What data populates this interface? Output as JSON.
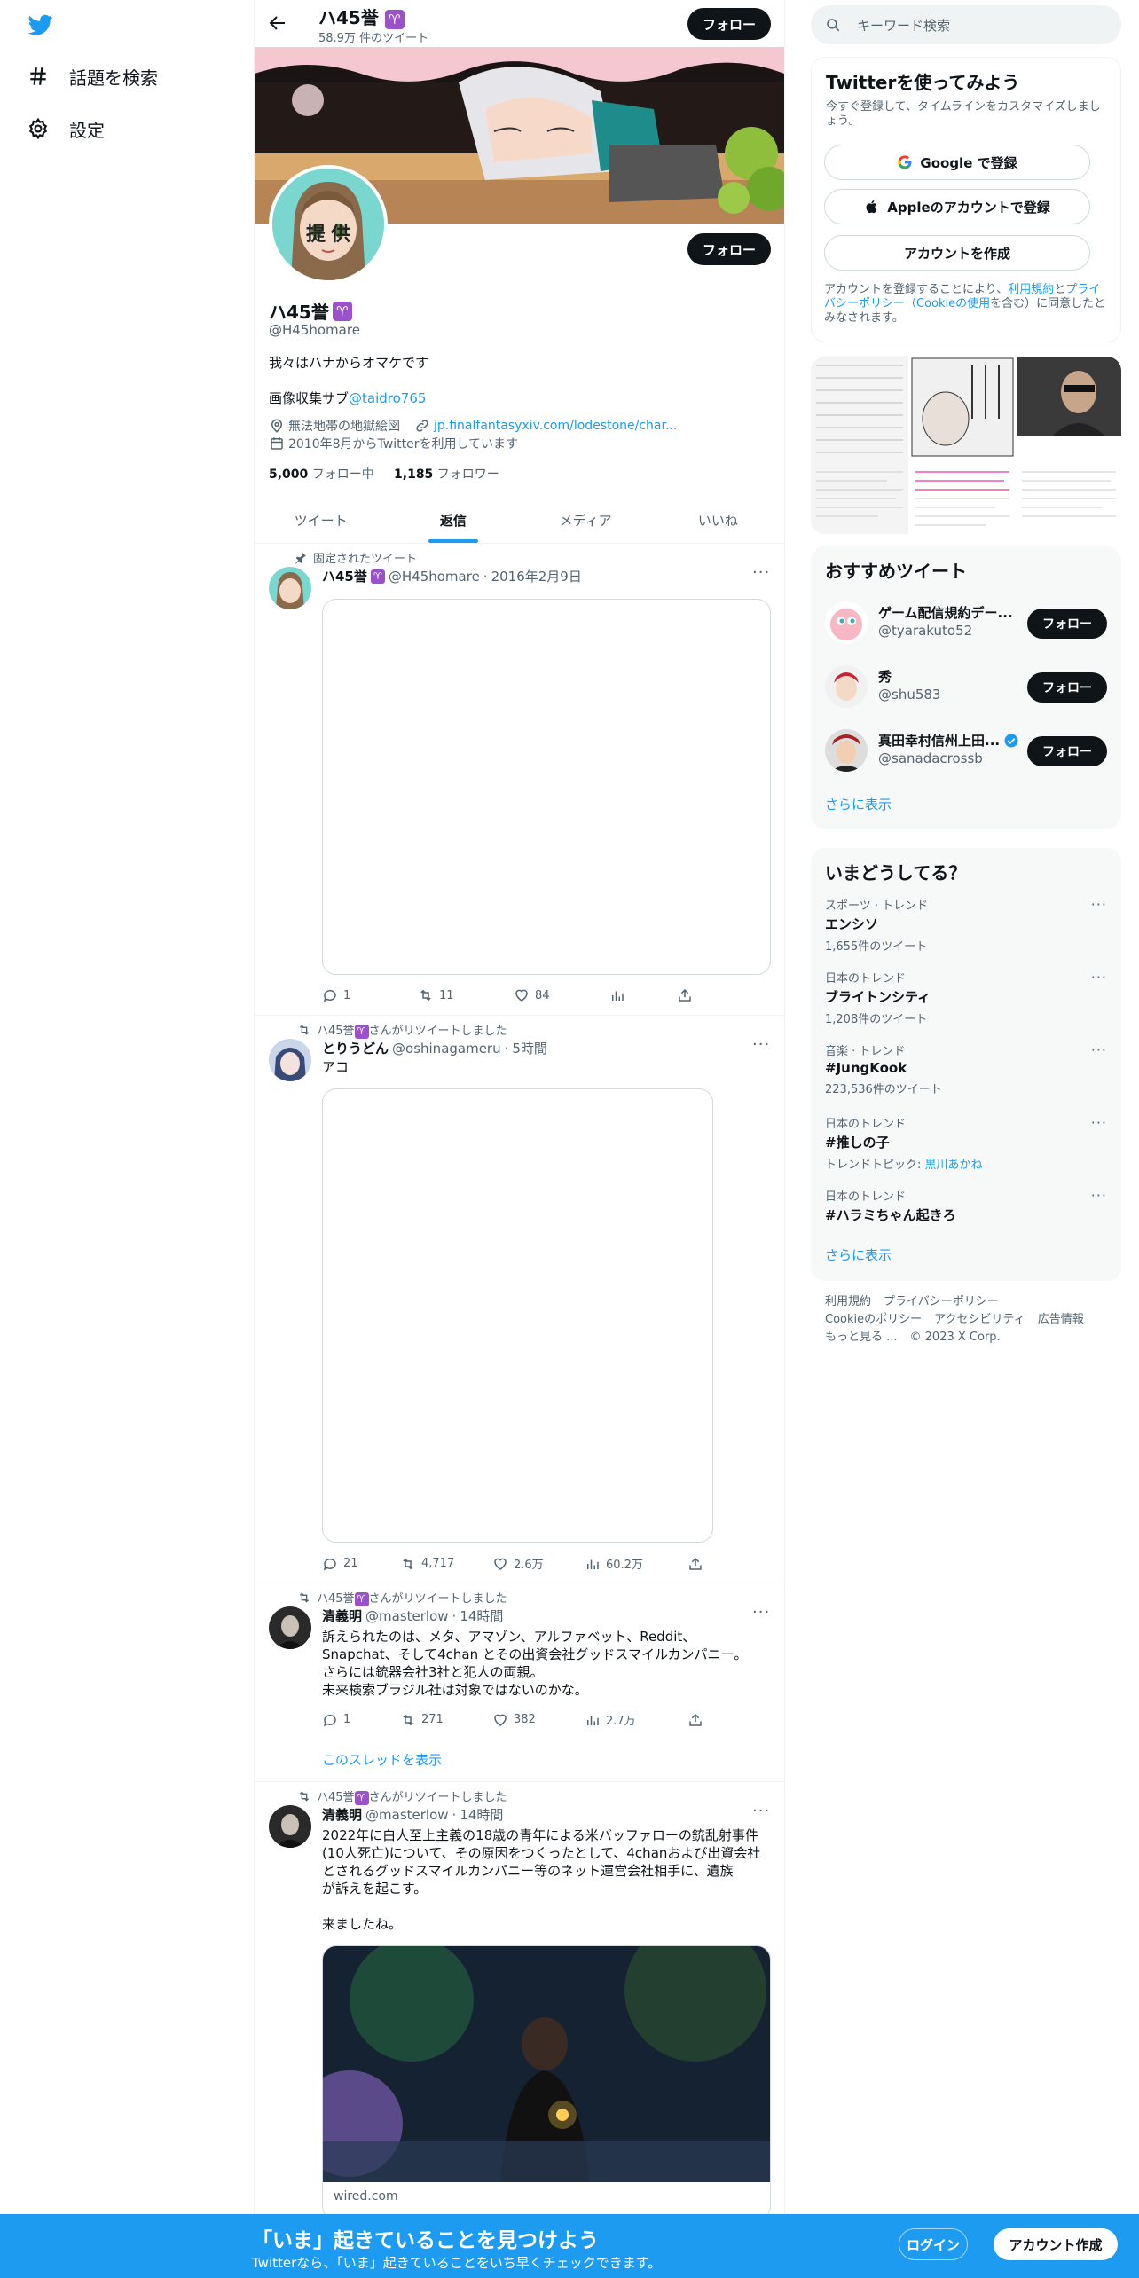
{
  "nav": {
    "items": [
      {
        "label": "話題を検索",
        "icon": "hashtag-icon"
      },
      {
        "label": "設定",
        "icon": "gear-icon"
      }
    ]
  },
  "header": {
    "name": "ハ45誉",
    "tweet_count": "58.9万 件のツイート",
    "follow_label": "フォロー"
  },
  "profile": {
    "avatar_label": "提供",
    "follow_label": "フォロー",
    "name": "ハ45誉",
    "handle": "@H45homare",
    "bio_line1": "我々はハナからオマケです",
    "bio_line2_prefix": "画像収集サブ",
    "bio_line2_link": "@taidro765",
    "location": "無法地帯の地獄絵図",
    "website": "jp.finalfantasyxiv.com/lodestone/char...",
    "joined": "2010年8月からTwitterを利用しています",
    "following_count": "5,000",
    "following_label": "フォロー中",
    "followers_count": "1,185",
    "followers_label": "フォロワー"
  },
  "tabs": [
    {
      "label": "ツイート",
      "active": false
    },
    {
      "label": "返信",
      "active": true
    },
    {
      "label": "メディア",
      "active": false
    },
    {
      "label": "いいね",
      "active": false
    }
  ],
  "tweets": [
    {
      "context": "固定されたツイート",
      "name": "ハ45誉",
      "handle": "@H45homare",
      "time": "2016年2月9日",
      "text": "",
      "replies": "1",
      "retweets": "11",
      "likes": "84",
      "views": ""
    },
    {
      "context_prefix": "ハ45誉",
      "context_suffix": "さんがリツイートしました",
      "name": "とりうどん",
      "handle": "@oshinagameru",
      "time": "5時間",
      "text": "アコ",
      "replies": "21",
      "retweets": "4,717",
      "likes": "2.6万",
      "views": "60.2万"
    },
    {
      "context_prefix": "ハ45誉",
      "context_suffix": "さんがリツイートしました",
      "name": "清義明",
      "handle": "@masterlow",
      "time": "14時間",
      "text": "訴えられたのは、メタ、アマゾン、アルファベット、Reddit、Snapchat、そして4chan とその出資会社グッドスマイルカンパニー。\nさらには銃器会社3社と犯人の両親。\n未来検索ブラジル社は対象ではないのかな。",
      "replies": "1",
      "retweets": "271",
      "likes": "382",
      "views": "2.7万",
      "show_thread": "このスレッドを表示"
    },
    {
      "context_prefix": "ハ45誉",
      "context_suffix": "さんがリツイートしました",
      "name": "清義明",
      "handle": "@masterlow",
      "time": "14時間",
      "text": "2022年に白人至上主義の18歳の青年による米バッファローの銃乱射事件(10人死亡)について、その原因をつくったとして、4chanおよび出資会社とされるグッドスマイルカンパニー等のネット運営会社相手に、遺族\nが訴えを起こす。\n\n来ましたね。",
      "link_domain": "wired.com"
    }
  ],
  "right": {
    "search_placeholder": "キーワード検索",
    "signup": {
      "title": "Twitterを使ってみよう",
      "subtitle": "今すぐ登録して、タイムラインをカスタマイズしましょう。",
      "google": "Google で登録",
      "apple": "Appleのアカウントで登録",
      "create": "アカウントを作成",
      "legal_prefix": "アカウントを登録することにより、",
      "legal_terms": "利用規約",
      "legal_and": "と",
      "legal_privacy": "プライバシーポリシー",
      "legal_cookie": "（Cookieの使用",
      "legal_suffix": "を含む）に同意したとみなされます。"
    },
    "reco": {
      "title": "おすすめツイート",
      "items": [
        {
          "name": "ゲーム配信規約デー...",
          "handle": "@tyarakuto52",
          "verified": false
        },
        {
          "name": "秀",
          "handle": "@shu583",
          "verified": false
        },
        {
          "name": "真田幸村信州上田...",
          "handle": "@sanadacrossb",
          "verified": true
        }
      ],
      "follow_label": "フォロー",
      "show_more": "さらに表示"
    },
    "trends": {
      "title": "いまどうしてる？",
      "items": [
        {
          "category": "スポーツ · トレンド",
          "title": "エンシソ",
          "count": "1,655件のツイート"
        },
        {
          "category": "日本のトレンド",
          "title": "ブライトンシティ",
          "count": "1,208件のツイート"
        },
        {
          "category": "音楽 · トレンド",
          "title": "#JungKook",
          "count": "223,536件のツイート"
        },
        {
          "category": "日本のトレンド",
          "title": "#推しの子",
          "count_prefix": "トレンドトピック: ",
          "count_link": "黒川あかね"
        },
        {
          "category": "日本のトレンド",
          "title": "#ハラミちゃん起きろ",
          "count": ""
        }
      ],
      "show_more": "さらに表示"
    },
    "footer": [
      "利用規約",
      "プライバシーポリシー",
      "Cookieのポリシー",
      "アクセシビリティ",
      "広告情報",
      "もっと見る ...",
      "© 2023 X Corp."
    ]
  },
  "bottom_bar": {
    "title": "「いま」起きていることを見つけよう",
    "subtitle": "Twitterなら、「いま」起きていることをいち早くチェックできます。",
    "login": "ログイン",
    "signup": "アカウント作成"
  },
  "colors": {
    "accent": "#1d9bf0",
    "text": "#0f1419",
    "secondary": "#536471",
    "aries": "#9b51c9"
  }
}
